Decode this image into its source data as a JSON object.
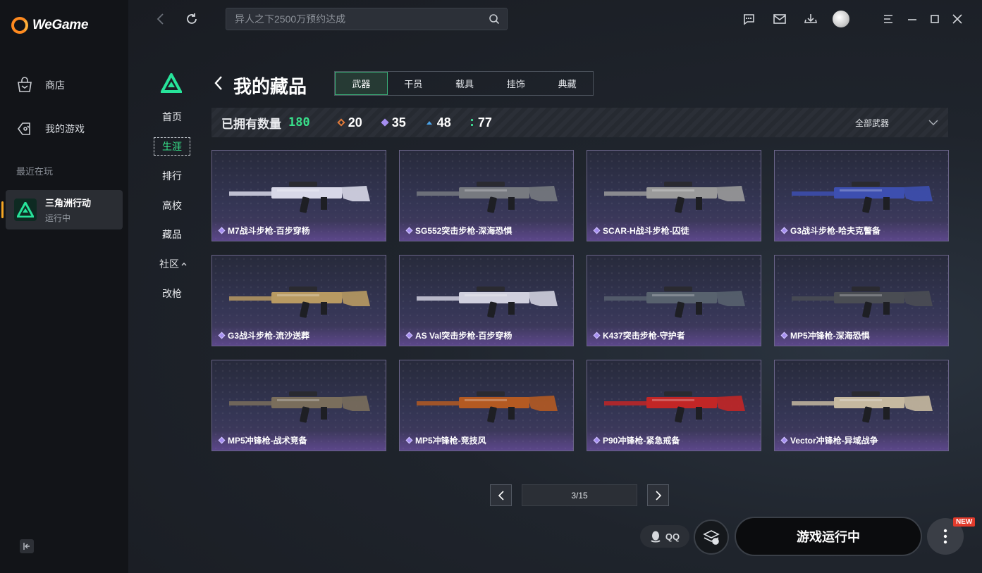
{
  "app": {
    "name": "WeGame"
  },
  "sidebar": {
    "nav": [
      {
        "label": "商店",
        "icon": "shop-bag-icon"
      },
      {
        "label": "我的游戏",
        "icon": "gamepad-icon"
      }
    ],
    "recent_label": "最近在玩",
    "recent_game": {
      "name": "三角洲行动",
      "status": "运行中"
    }
  },
  "topbar": {
    "search_placeholder": "异人之下2500万预约达成",
    "icons": [
      "back-arrow-icon",
      "refresh-icon",
      "search-icon",
      "chat-icon",
      "mail-icon",
      "download-icon",
      "avatar",
      "menu-icon",
      "minimize-icon",
      "maximize-icon",
      "close-icon"
    ]
  },
  "game_nav": [
    {
      "label": "首页",
      "active": false
    },
    {
      "label": "生涯",
      "active": true
    },
    {
      "label": "排行",
      "active": false
    },
    {
      "label": "高校",
      "active": false
    },
    {
      "label": "藏品",
      "active": false
    },
    {
      "label": "社区",
      "active": false,
      "has_submenu": true
    },
    {
      "label": "改枪",
      "active": false
    }
  ],
  "collection": {
    "title": "我的藏品",
    "tabs": [
      {
        "label": "武器",
        "active": true
      },
      {
        "label": "干员",
        "active": false
      },
      {
        "label": "载具",
        "active": false
      },
      {
        "label": "挂饰",
        "active": false
      },
      {
        "label": "典藏",
        "active": false
      }
    ],
    "owned_label": "已拥有数量",
    "owned_count": "180",
    "rarity_counts": [
      {
        "value": "20",
        "color": "#e07a3a"
      },
      {
        "value": "35",
        "color": "#a58ef0"
      },
      {
        "value": "48",
        "color": "#4aa3e8"
      },
      {
        "value": "77",
        "color": "#3ecf8e"
      }
    ],
    "filter_label": "全部武器",
    "items": [
      {
        "name": "M7战斗步枪-百步穿杨",
        "tone": "#d8d8e8"
      },
      {
        "name": "SG552突击步枪-深海恐惧",
        "tone": "#777a80"
      },
      {
        "name": "SCAR-H战斗步枪-囚徒",
        "tone": "#9a9a9a"
      },
      {
        "name": "G3战斗步枪-哈夫克警备",
        "tone": "#3d4fb0"
      },
      {
        "name": "G3战斗步枪-流沙送葬",
        "tone": "#b89a62"
      },
      {
        "name": "AS Val突击步枪-百步穿杨",
        "tone": "#d0d0de"
      },
      {
        "name": "K437突击步枪-守护者",
        "tone": "#58626e"
      },
      {
        "name": "MP5冲锋枪-深海恐惧",
        "tone": "#4a4d53"
      },
      {
        "name": "MP5冲锋枪-战术竞备",
        "tone": "#7a6e5c"
      },
      {
        "name": "MP5冲锋枪-竞技风",
        "tone": "#b45a22"
      },
      {
        "name": "P90冲锋枪-紧急戒备",
        "tone": "#c22626"
      },
      {
        "name": "Vector冲锋枪-异域战争",
        "tone": "#c6b9a0"
      }
    ]
  },
  "pagination": {
    "current": "3/15"
  },
  "actions": {
    "qq_label": "QQ",
    "run_label": "游戏运行中",
    "new_badge": "NEW"
  }
}
